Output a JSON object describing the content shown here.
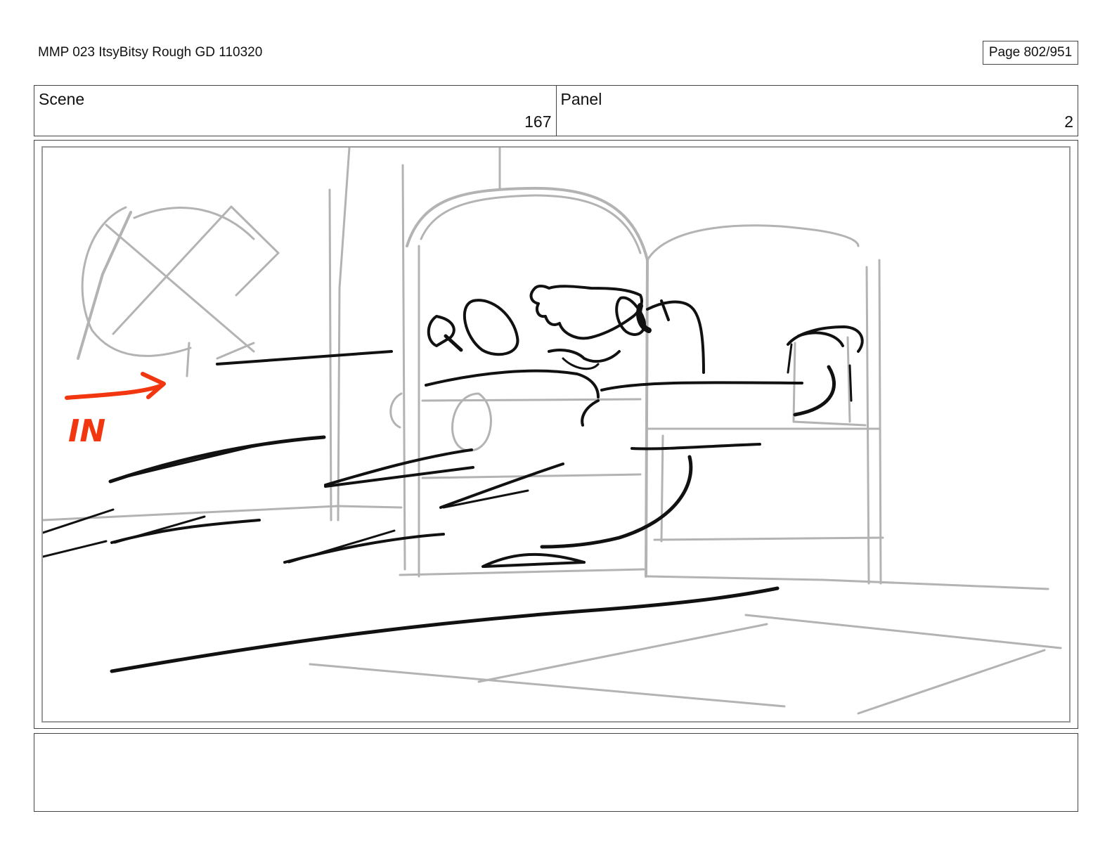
{
  "header": {
    "document_title": "MMP 023 ItsyBitsy Rough GD 110320",
    "page_label": "Page 802/951"
  },
  "meta": {
    "scene_label": "Scene",
    "scene_value": "167",
    "panel_label": "Panel",
    "panel_value": "2"
  },
  "sketch": {
    "annotation_text": "IN",
    "annotation_color": "#f2360f"
  },
  "notes": {
    "text": ""
  }
}
